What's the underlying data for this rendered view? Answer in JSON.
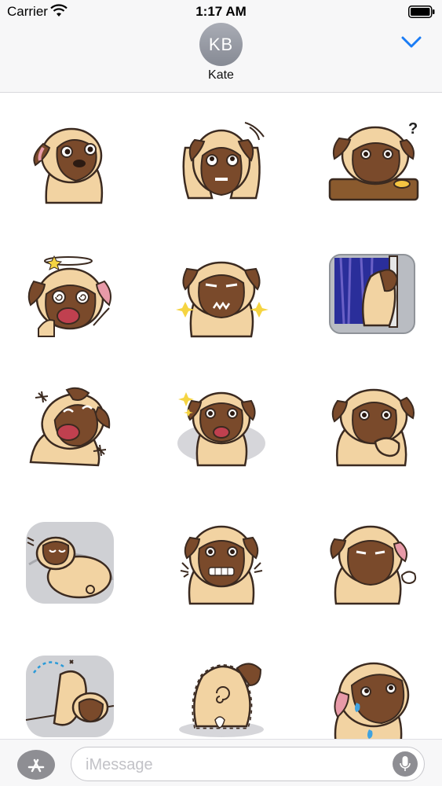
{
  "status_bar": {
    "carrier": "Carrier",
    "time": "1:17 AM"
  },
  "header": {
    "avatar_initials": "KB",
    "contact_name": "Kate"
  },
  "stickers": [
    {
      "icon": "pug-head-tilt-sticker"
    },
    {
      "icon": "pug-shocked-hands-sticker"
    },
    {
      "icon": "pug-confused-table-sticker",
      "text": "?"
    },
    {
      "icon": "pug-dizzy-sticker"
    },
    {
      "icon": "pug-grumpy-sparkle-sticker"
    },
    {
      "icon": "pug-window-night-sticker"
    },
    {
      "icon": "pug-laughing-sticker"
    },
    {
      "icon": "pug-sitting-happy-sticker"
    },
    {
      "icon": "pug-thinking-sticker"
    },
    {
      "icon": "pug-sleeping-sticker"
    },
    {
      "icon": "pug-nervous-sticker"
    },
    {
      "icon": "pug-sighing-sticker"
    },
    {
      "icon": "pug-peeing-sticker"
    },
    {
      "icon": "pug-tail-sticker"
    },
    {
      "icon": "pug-sweating-sticker"
    }
  ],
  "input_bar": {
    "placeholder": "iMessage"
  },
  "colors": {
    "accent": "#1a7cf5",
    "pug_fur": "#f2d3a2",
    "pug_mask": "#7a4a2b",
    "outline": "#3b2a20"
  }
}
